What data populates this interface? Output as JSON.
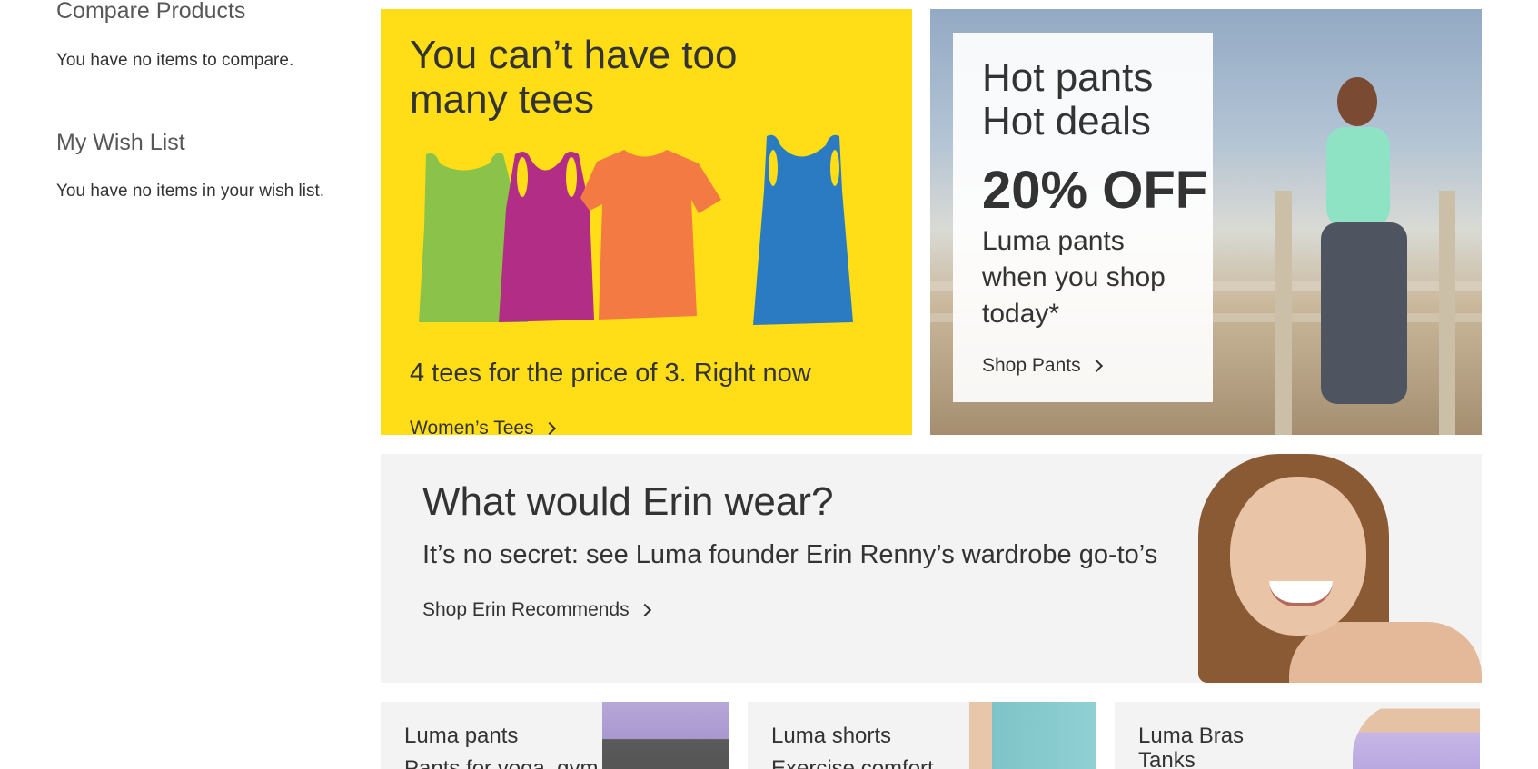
{
  "sidebar": {
    "compare_title": "Compare Products",
    "compare_empty": "You have no items to compare.",
    "wishlist_title": "My Wish List",
    "wishlist_empty": "You have no items in your wish list."
  },
  "tees_block": {
    "heading": "You can’t have too many tees",
    "promo": "4 tees for the price of 3. Right now",
    "link": "Women’s Tees",
    "tee_colors": [
      "#8bc34a",
      "#b22e86",
      "#f47a44",
      "#2a7bc2"
    ]
  },
  "pants_block": {
    "heading_line1": "Hot pants",
    "heading_line2": "Hot deals",
    "discount": "20% OFF",
    "description": "Luma pants when you shop today*",
    "link": "Shop Pants"
  },
  "erin_block": {
    "heading": "What would Erin wear?",
    "subheading": "It’s no secret: see Luma founder Erin Renny’s wardrobe go-to’s",
    "link": "Shop Erin Recommends"
  },
  "categories": [
    {
      "name": "Luma pants",
      "tagline": "Pants for yoga, gym"
    },
    {
      "name": "Luma shorts",
      "tagline": "Exercise comfort"
    },
    {
      "name": "Luma Bras Tanks",
      "tagline": ""
    }
  ],
  "colors": {
    "tees_background": "#ffde17",
    "panel_gray": "#f3f3f3",
    "text": "#333333"
  }
}
